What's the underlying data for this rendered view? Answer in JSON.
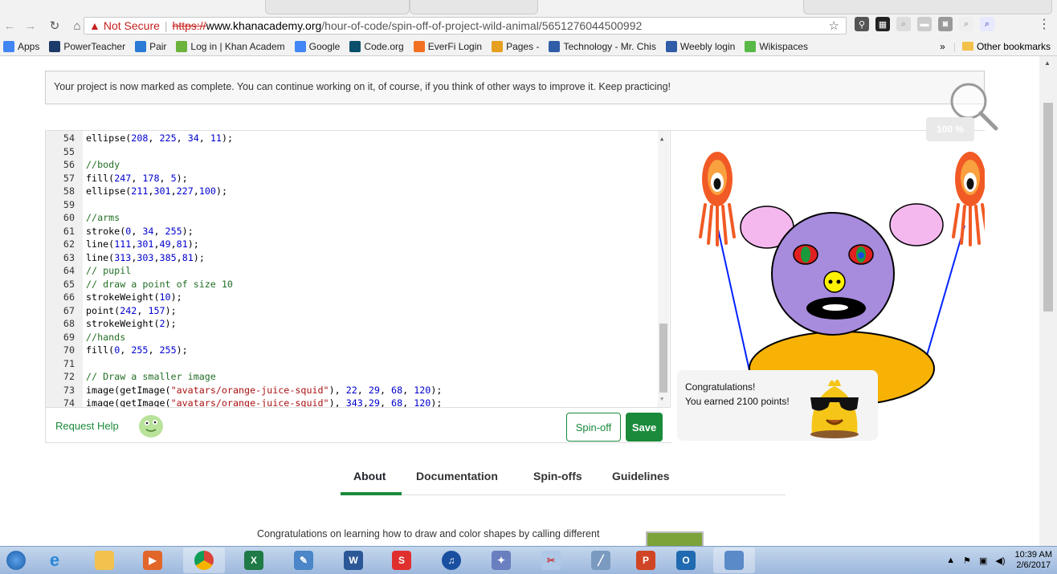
{
  "browser": {
    "not_secure_label": "Not Secure",
    "url_scheme": "https://",
    "url_domain": "www.khanacademy.org",
    "url_path": "/hour-of-code/spin-off-of-project-wild-animal/5651276044500992"
  },
  "bookmarks": {
    "items": [
      {
        "label": "Apps",
        "color": "#4285f4",
        "icon": "apps-grid-icon"
      },
      {
        "label": "PowerTeacher",
        "color": "#1d3b6a",
        "icon": "powerteacher-icon"
      },
      {
        "label": "Pair",
        "color": "#2b7bd6",
        "icon": "infinity-icon"
      },
      {
        "label": "Log in | Khan Academ",
        "color": "#6bb33b",
        "icon": "leaf-icon"
      },
      {
        "label": "Google",
        "color": "#4285f4",
        "icon": "google-icon"
      },
      {
        "label": "Code.org",
        "color": "#0b4f6c",
        "icon": "codeorg-icon"
      },
      {
        "label": "EverFi Login",
        "color": "#f27022",
        "icon": "everfi-icon"
      },
      {
        "label": "Pages -",
        "color": "#e6a021",
        "icon": "pages-icon"
      },
      {
        "label": "Technology - Mr. Chis",
        "color": "#2f5da8",
        "icon": "weebly-icon"
      },
      {
        "label": "Weebly login",
        "color": "#2f5da8",
        "icon": "weebly-icon"
      },
      {
        "label": "Wikispaces",
        "color": "#58b947",
        "icon": "wikispaces-icon"
      }
    ],
    "overflow": "»",
    "other_bookmarks": "Other bookmarks"
  },
  "notice": {
    "text": "Your project is now marked as complete. You can continue working on it, of course, if you think of other ways to improve it. Keep practicing!"
  },
  "zoom_label": "100 %",
  "editor": {
    "lines": [
      {
        "n": "54",
        "parts": [
          [
            "txt",
            "ellipse("
          ],
          [
            "num",
            "208"
          ],
          [
            "txt",
            ", "
          ],
          [
            "num",
            "225"
          ],
          [
            "txt",
            ", "
          ],
          [
            "num",
            "34"
          ],
          [
            "txt",
            ", "
          ],
          [
            "num",
            "11"
          ],
          [
            "txt",
            ");"
          ]
        ]
      },
      {
        "n": "55",
        "parts": []
      },
      {
        "n": "56",
        "parts": [
          [
            "com",
            "//body"
          ]
        ]
      },
      {
        "n": "57",
        "parts": [
          [
            "txt",
            "fill("
          ],
          [
            "num",
            "247"
          ],
          [
            "txt",
            ", "
          ],
          [
            "num",
            "178"
          ],
          [
            "txt",
            ", "
          ],
          [
            "num",
            "5"
          ],
          [
            "txt",
            ");"
          ]
        ]
      },
      {
        "n": "58",
        "parts": [
          [
            "txt",
            "ellipse("
          ],
          [
            "num",
            "211"
          ],
          [
            "txt",
            ","
          ],
          [
            "num",
            "301"
          ],
          [
            "txt",
            ","
          ],
          [
            "num",
            "227"
          ],
          [
            "txt",
            ","
          ],
          [
            "num",
            "100"
          ],
          [
            "txt",
            ");"
          ]
        ]
      },
      {
        "n": "59",
        "parts": []
      },
      {
        "n": "60",
        "parts": [
          [
            "com",
            "//arms"
          ]
        ]
      },
      {
        "n": "61",
        "parts": [
          [
            "txt",
            "stroke("
          ],
          [
            "num",
            "0"
          ],
          [
            "txt",
            ", "
          ],
          [
            "num",
            "34"
          ],
          [
            "txt",
            ", "
          ],
          [
            "num",
            "255"
          ],
          [
            "txt",
            ");"
          ]
        ]
      },
      {
        "n": "62",
        "parts": [
          [
            "txt",
            "line("
          ],
          [
            "num",
            "111"
          ],
          [
            "txt",
            ","
          ],
          [
            "num",
            "301"
          ],
          [
            "txt",
            ","
          ],
          [
            "num",
            "49"
          ],
          [
            "txt",
            ","
          ],
          [
            "num",
            "81"
          ],
          [
            "txt",
            ");"
          ]
        ]
      },
      {
        "n": "63",
        "parts": [
          [
            "txt",
            "line("
          ],
          [
            "num",
            "313"
          ],
          [
            "txt",
            ","
          ],
          [
            "num",
            "303"
          ],
          [
            "txt",
            ","
          ],
          [
            "num",
            "385"
          ],
          [
            "txt",
            ","
          ],
          [
            "num",
            "81"
          ],
          [
            "txt",
            ");"
          ]
        ]
      },
      {
        "n": "64",
        "parts": [
          [
            "com",
            "// pupil"
          ]
        ]
      },
      {
        "n": "65",
        "parts": [
          [
            "com",
            "// draw a point of size 10"
          ]
        ]
      },
      {
        "n": "66",
        "parts": [
          [
            "txt",
            "strokeWeight("
          ],
          [
            "num",
            "10"
          ],
          [
            "txt",
            ");"
          ]
        ]
      },
      {
        "n": "67",
        "parts": [
          [
            "txt",
            "point("
          ],
          [
            "num",
            "242"
          ],
          [
            "txt",
            ", "
          ],
          [
            "num",
            "157"
          ],
          [
            "txt",
            ");"
          ]
        ]
      },
      {
        "n": "68",
        "parts": [
          [
            "txt",
            "strokeWeight("
          ],
          [
            "num",
            "2"
          ],
          [
            "txt",
            ");"
          ]
        ]
      },
      {
        "n": "69",
        "parts": [
          [
            "com",
            "//hands"
          ]
        ]
      },
      {
        "n": "70",
        "parts": [
          [
            "txt",
            "fill("
          ],
          [
            "num",
            "0"
          ],
          [
            "txt",
            ", "
          ],
          [
            "num",
            "255"
          ],
          [
            "txt",
            ", "
          ],
          [
            "num",
            "255"
          ],
          [
            "txt",
            ");"
          ]
        ]
      },
      {
        "n": "71",
        "parts": []
      },
      {
        "n": "72",
        "parts": [
          [
            "com",
            "// Draw a smaller image"
          ]
        ]
      },
      {
        "n": "73",
        "parts": [
          [
            "txt",
            "image(getImage("
          ],
          [
            "str",
            "\"avatars/orange-juice-squid\""
          ],
          [
            "txt",
            "), "
          ],
          [
            "num",
            "22"
          ],
          [
            "txt",
            ", "
          ],
          [
            "num",
            "29"
          ],
          [
            "txt",
            ", "
          ],
          [
            "num",
            "68"
          ],
          [
            "txt",
            ", "
          ],
          [
            "num",
            "120"
          ],
          [
            "txt",
            ");"
          ]
        ]
      },
      {
        "n": "74",
        "parts": [
          [
            "txt",
            "image(getImage("
          ],
          [
            "str",
            "\"avatars/orange-juice-squid\""
          ],
          [
            "txt",
            "), "
          ],
          [
            "num",
            "343"
          ],
          [
            "txt",
            ","
          ],
          [
            "num",
            "29"
          ],
          [
            "txt",
            ", "
          ],
          [
            "num",
            "68"
          ],
          [
            "txt",
            ", "
          ],
          [
            "num",
            "120"
          ],
          [
            "txt",
            ");"
          ]
        ]
      }
    ]
  },
  "footer": {
    "request_help": "Request Help",
    "spinoff": "Spin-off",
    "save": "Save"
  },
  "congrats": {
    "title": "Congratulations!",
    "points": "You earned 2100 points!"
  },
  "tabs": [
    "About",
    "Documentation",
    "Spin-offs",
    "Guidelines"
  ],
  "about_text": "Congratulations on learning how to draw and color shapes by calling different",
  "taskbar": {
    "time": "10:39 AM",
    "date": "2/6/2017"
  },
  "colors": {
    "accent_green": "#1a8a3b",
    "body_fill": "#f7b205",
    "head_fill": "#a78bdd",
    "ear_fill": "#f4b8ee",
    "arm_stroke": "#0022ff"
  }
}
